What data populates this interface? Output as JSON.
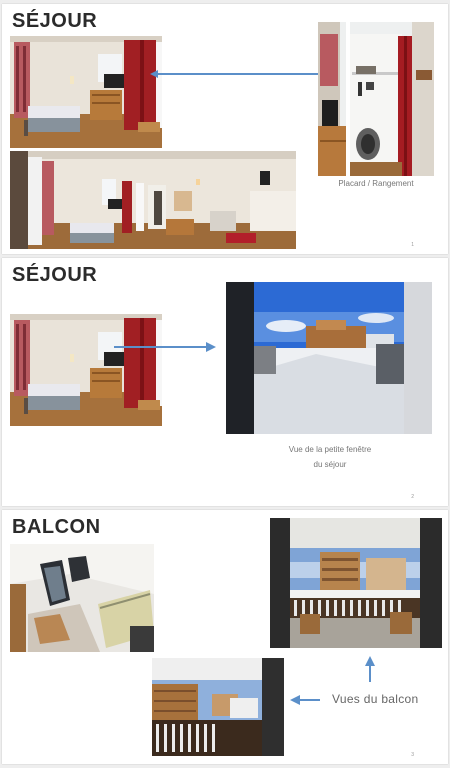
{
  "slides": [
    {
      "title": "SÉJOUR",
      "caption": "Placard / Rangement",
      "page": "1",
      "photos": [
        "room-bed-window-icon",
        "wardrobe-closet-icon",
        "room-panorama-icon"
      ]
    },
    {
      "title": "SÉJOUR",
      "caption_line1": "Vue de la petite fenêtre",
      "caption_line2": "du séjour",
      "page": "2",
      "photos": [
        "room-bed-window-icon",
        "snowy-village-view-icon"
      ]
    },
    {
      "title": "BALCON",
      "label": "Vues du balcon",
      "page": "3",
      "photos": [
        "balcony-chairs-icon",
        "balcony-view-icon",
        "balcony-railing-icon"
      ]
    }
  ],
  "colors": {
    "accent_arrow": "#5b8fc9",
    "title": "#2b2b2b",
    "caption": "#777777"
  }
}
